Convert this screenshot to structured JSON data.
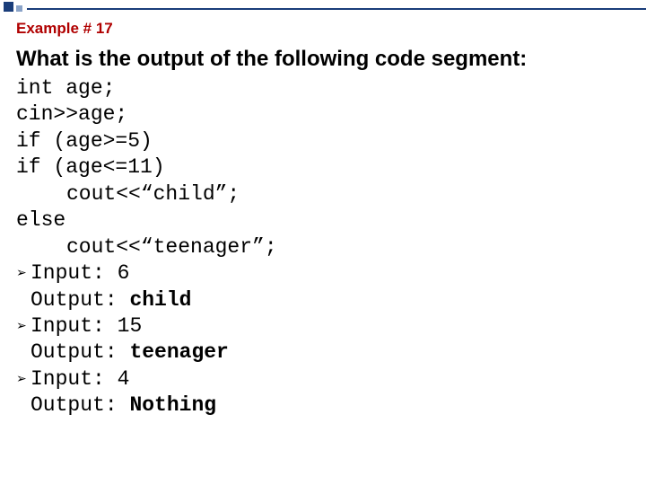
{
  "header": {
    "example_label": "Example # 17"
  },
  "question": "What is the output of the following code segment:",
  "code": {
    "l1": "int age;",
    "l2": "cin>>age;",
    "l3": "if (age>=5)",
    "l4": "if (age<=11)",
    "l5": "cout<<“child”;",
    "l6": "else",
    "l7": "cout<<“teenager”;"
  },
  "io": {
    "case1": {
      "input_label": "Input:",
      "input_value": "6",
      "output_label": "Output:",
      "output_value": "child"
    },
    "case2": {
      "input_label": "Input:",
      "input_value": "15",
      "output_label": "Output:",
      "output_value": "teenager"
    },
    "case3": {
      "input_label": "Input:",
      "input_value": "4",
      "output_label": "Output:",
      "output_value": "Nothing"
    }
  },
  "glyph": {
    "bullet": "➢"
  }
}
